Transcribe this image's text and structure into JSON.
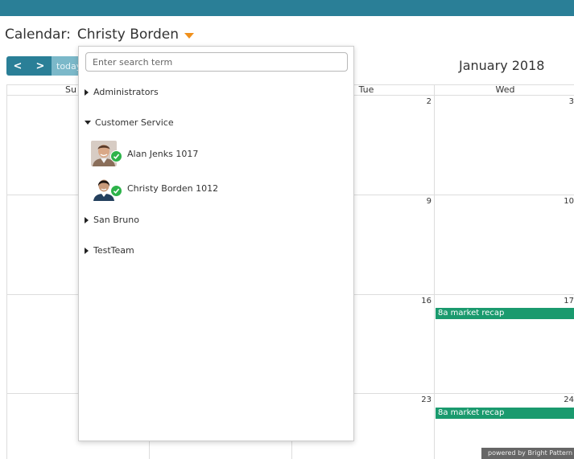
{
  "header": {
    "prefix": "Calendar:",
    "calendar_name": "Christy Borden"
  },
  "toolbar": {
    "prev_label": "<",
    "next_label": ">",
    "today_label": "today",
    "month_title": "January 2018"
  },
  "grid": {
    "day_headers": [
      "Su",
      "Tue",
      "Wed"
    ],
    "day_numbers": [
      "2",
      "3",
      "9",
      "10",
      "16",
      "17",
      "23",
      "24"
    ],
    "events": [
      {
        "day": "17",
        "label": "8a market recap"
      },
      {
        "day": "24",
        "label": "8a market recap"
      }
    ],
    "event_color": "#1a9a6e"
  },
  "dropdown": {
    "search_placeholder": "Enter search term",
    "groups": [
      {
        "label": "Administrators",
        "expanded": false
      },
      {
        "label": "Customer Service",
        "expanded": true
      },
      {
        "label": "San Bruno",
        "expanded": false
      },
      {
        "label": "TestTeam",
        "expanded": false
      }
    ],
    "agents": [
      {
        "name": "Alan Jenks 1017",
        "status": "available"
      },
      {
        "name": "Christy Borden 1012",
        "status": "available"
      }
    ]
  },
  "footer": {
    "powered_by": "powered by Bright Pattern"
  },
  "colors": {
    "topbar": "#2a7f97",
    "accent_caret": "#f0901c",
    "status_available": "#2db34a"
  }
}
